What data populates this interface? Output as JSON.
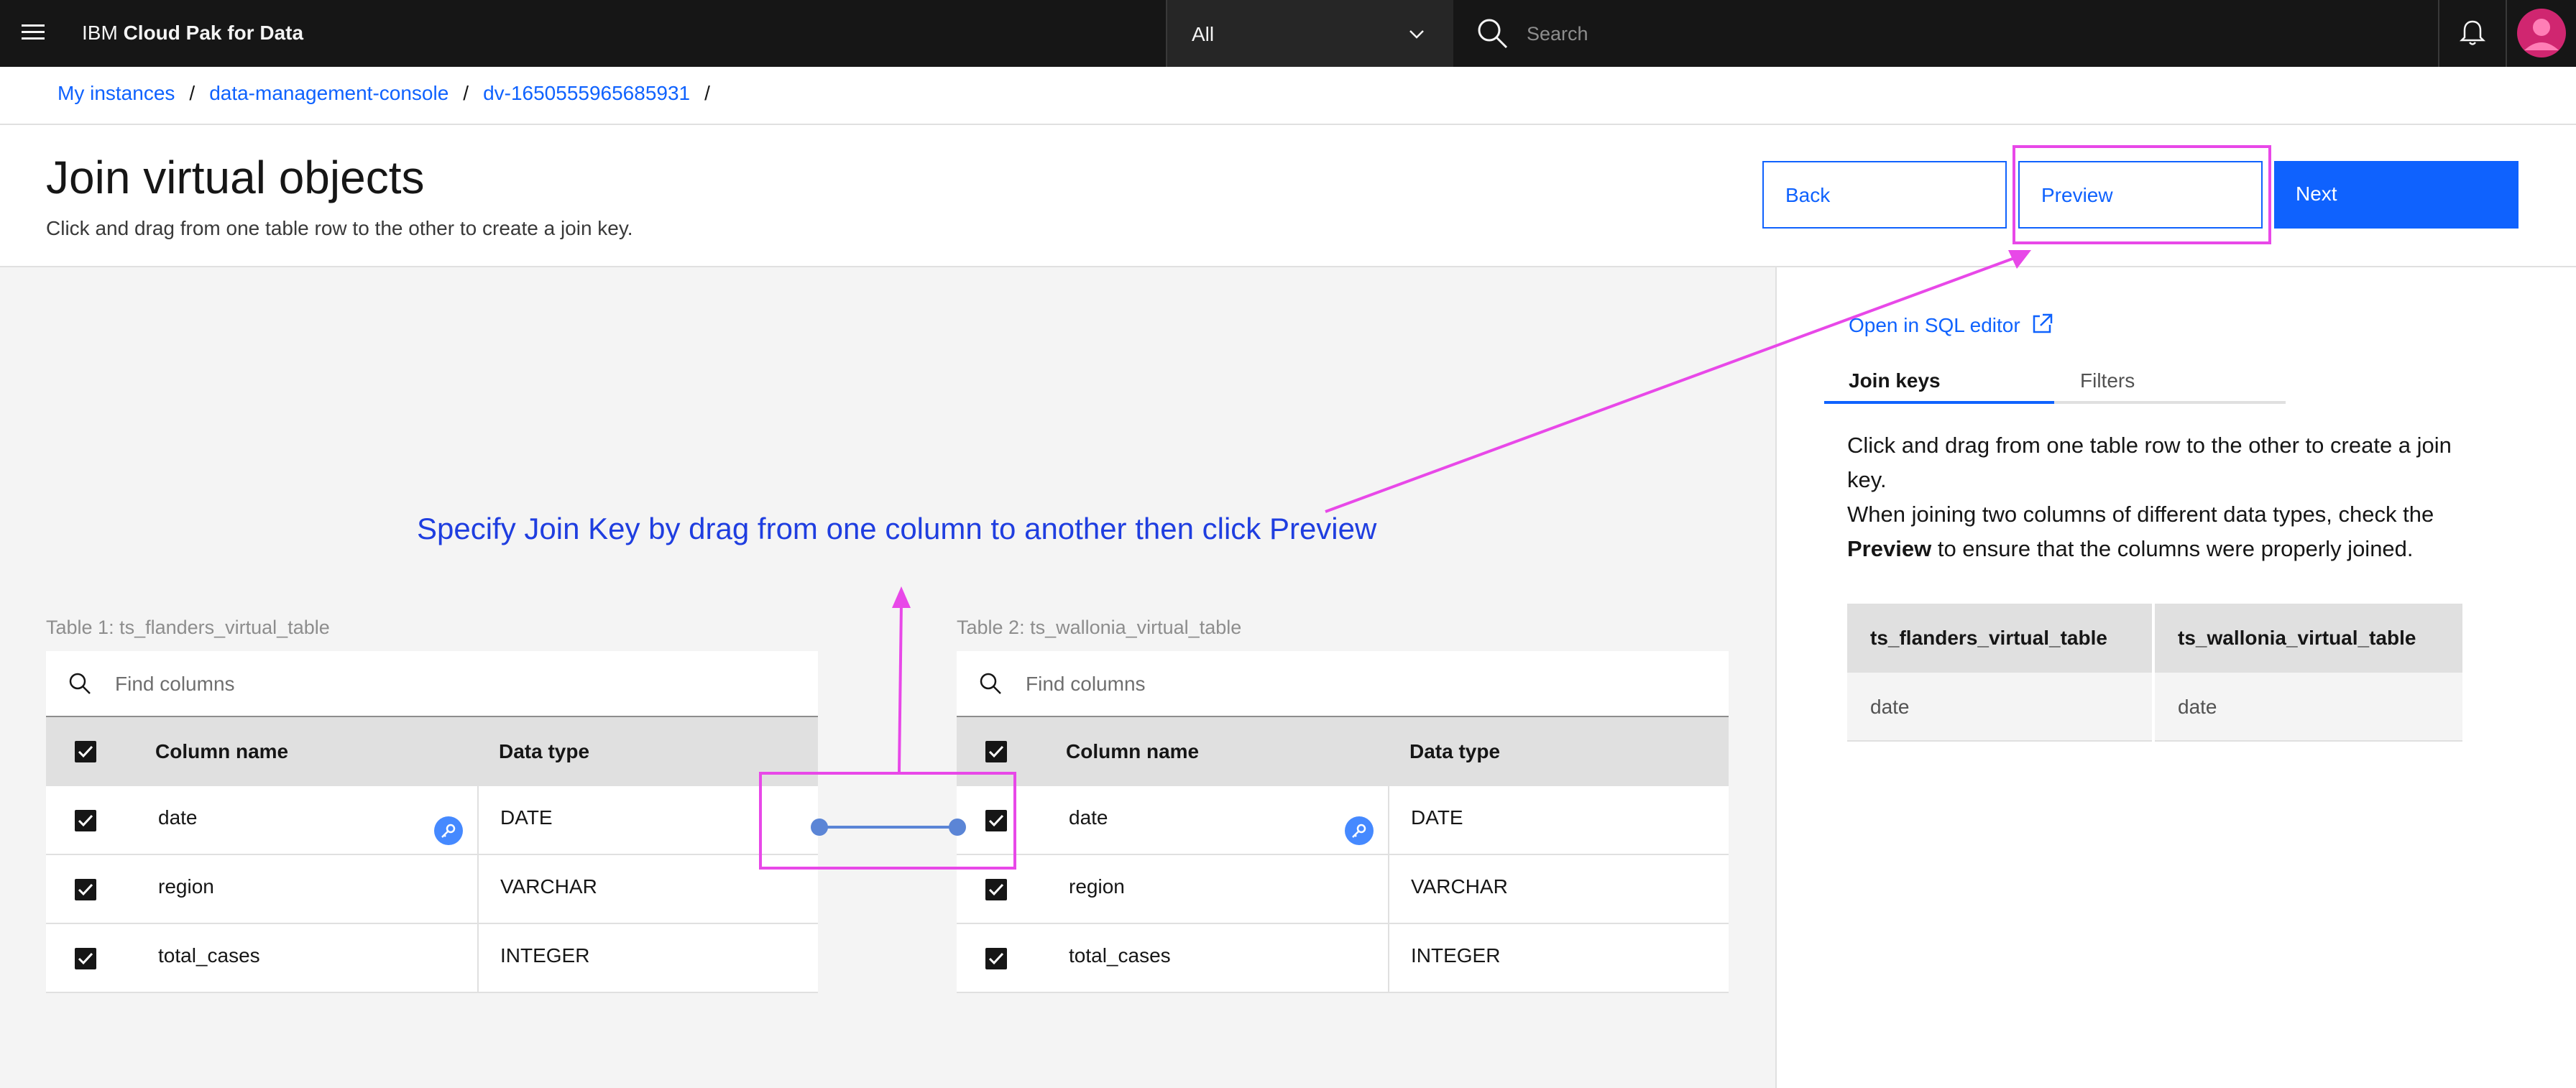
{
  "header": {
    "brand_prefix": "IBM",
    "brand_name": "Cloud Pak for Data",
    "scope_selected": "All",
    "search_placeholder": "Search"
  },
  "breadcrumb": [
    "My instances",
    "data-management-console",
    "dv-1650555965685931"
  ],
  "breadcrumb_separator": "/",
  "page": {
    "title": "Join virtual objects",
    "subtitle": "Click and drag from one table row to the other to create a join key."
  },
  "actions": {
    "back": "Back",
    "preview": "Preview",
    "next": "Next"
  },
  "annotation": {
    "text": "Specify Join Key by drag from one column to another then click Preview",
    "color": "#1f3ee0",
    "highlight_color": "#e848e8"
  },
  "table1": {
    "label": "Table 1: ts_flanders_virtual_table",
    "search_placeholder": "Find columns",
    "headers": [
      "Column name",
      "Data type"
    ],
    "rows": [
      {
        "name": "date",
        "type": "DATE",
        "join_key": true
      },
      {
        "name": "region",
        "type": "VARCHAR",
        "join_key": false
      },
      {
        "name": "total_cases",
        "type": "INTEGER",
        "join_key": false
      }
    ]
  },
  "table2": {
    "label": "Table 2: ts_wallonia_virtual_table",
    "search_placeholder": "Find columns",
    "headers": [
      "Column name",
      "Data type"
    ],
    "rows": [
      {
        "name": "date",
        "type": "DATE",
        "join_key": true
      },
      {
        "name": "region",
        "type": "VARCHAR",
        "join_key": false
      },
      {
        "name": "total_cases",
        "type": "INTEGER",
        "join_key": false
      }
    ]
  },
  "side_panel": {
    "sql_link": "Open in SQL editor",
    "tabs": [
      {
        "label": "Join keys",
        "active": true
      },
      {
        "label": "Filters",
        "active": false
      }
    ],
    "help_line1": "Click and drag from one table row to the other to create a join key.",
    "help_line2_prefix": "When joining two columns of different data types, check the",
    "help_line2_bold": "Preview",
    "help_line2_suffix": "to ensure that the columns were properly joined.",
    "join_table": {
      "headers": [
        "ts_flanders_virtual_table",
        "ts_wallonia_virtual_table"
      ],
      "rows": [
        [
          "date",
          "date"
        ]
      ]
    }
  },
  "colors": {
    "primary": "#0f62fe",
    "header_bg": "#161616",
    "avatar": "#d02670",
    "join_line": "#5b85d6"
  }
}
